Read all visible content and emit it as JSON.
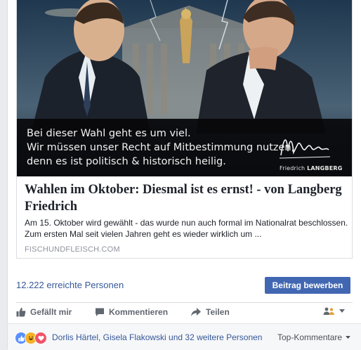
{
  "link_preview": {
    "caption_lines": [
      "Bei dieser Wahl geht es um viel.",
      "Wir müssen unser Recht auf Mitbestimmung nutzen,",
      "denn es ist politisch & historisch heilig."
    ],
    "signature_first": "Friedrich",
    "signature_last": "LANGBERG",
    "title": "Wahlen im Oktober: Diesmal ist es ernst! - von Langberg Friedrich",
    "description": "Am 15. Oktober wird gewählt - das wurde nun auch formal im Nationalrat beschlossen. Zum ersten Mal seit vielen Jahren geht es wieder wirklich um ...",
    "domain": "FISCHUNDFLEISCH.COM"
  },
  "reach": {
    "text": "12.222 erreichte Personen",
    "boost_label": "Beitrag bewerben"
  },
  "actions": {
    "like": "Gefällt mir",
    "comment": "Kommentieren",
    "share": "Teilen"
  },
  "comment_bar": {
    "reactors": "Dorlis Härtel, Gisela Flakowski und 32 weitere Personen",
    "sort_label": "Top-Kommentare",
    "reaction_icons": [
      "like-reaction",
      "haha-reaction",
      "love-reaction"
    ]
  },
  "colors": {
    "brand": "#4267b2",
    "link": "#365899",
    "text": "#1d2129"
  }
}
